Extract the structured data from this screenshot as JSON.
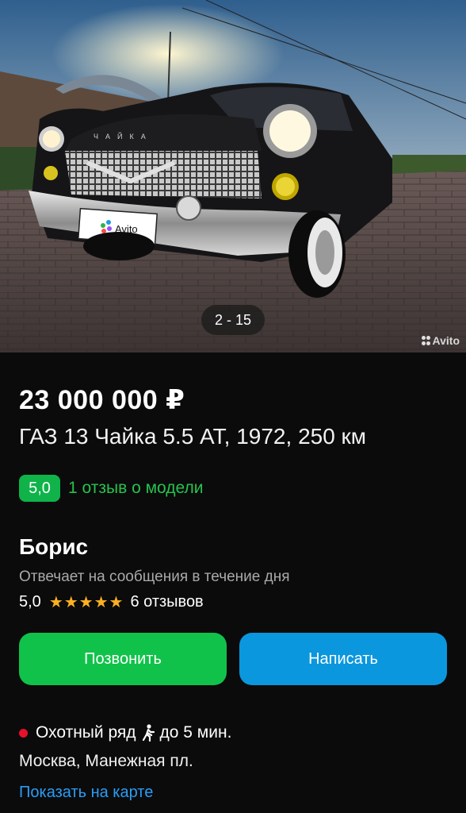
{
  "gallery": {
    "counter": "2 - 15",
    "watermark": "Avito",
    "plate_text": "Avito",
    "emblem_text": "ЧАЙКА"
  },
  "listing": {
    "price": "23 000 000 ₽",
    "title": "ГАЗ 13 Чайка 5.5 AT, 1972, 250 км",
    "model_rating": "5,0",
    "model_reviews": "1 отзыв о модели"
  },
  "seller": {
    "name": "Борис",
    "response": "Отвечает на сообщения в течение дня",
    "rating": "5,0",
    "stars": "★★★★★",
    "reviews": "6 отзывов"
  },
  "actions": {
    "call": "Позвонить",
    "write": "Написать"
  },
  "location": {
    "metro": "Охотный ряд",
    "walk_time": "до 5 мин.",
    "address": "Москва, Манежная пл.",
    "map_link": "Показать на карте"
  },
  "colors": {
    "background": "#0b0b0c",
    "green": "#11c24a",
    "blue": "#0a97dd",
    "link": "#2a9df4",
    "star": "#ffb020",
    "metro_dot": "#e8102a"
  }
}
